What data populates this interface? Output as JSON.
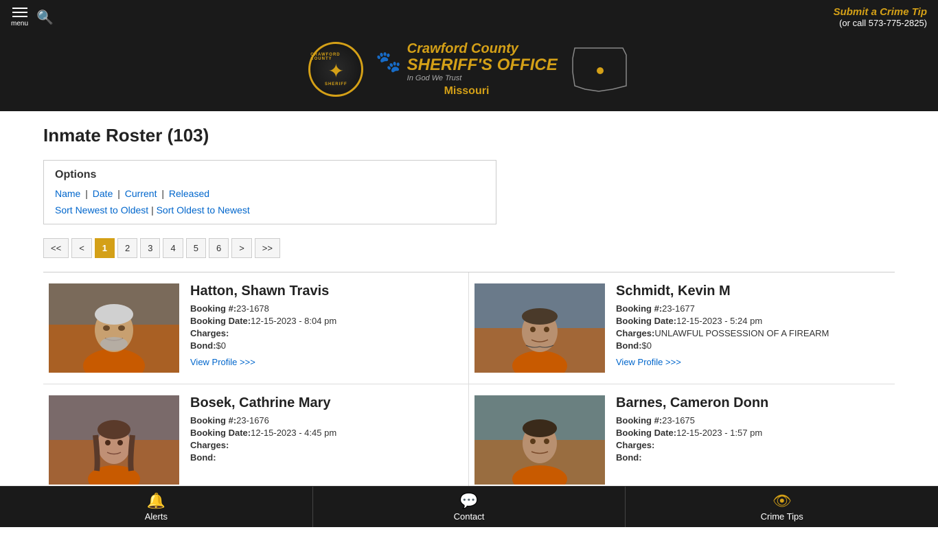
{
  "header": {
    "menu_label": "menu",
    "crime_tip_text": "Submit a Crime Tip",
    "crime_tip_phone": "(or call 573-775-2825)"
  },
  "logo": {
    "county": "Crawford County",
    "office": "SHERIFF'S OFFICE",
    "tagline": "In God We Trust",
    "state": "Missouri"
  },
  "page": {
    "title": "Inmate Roster (103)"
  },
  "options": {
    "title": "Options",
    "filter_links": [
      {
        "label": "Name",
        "href": "#"
      },
      {
        "label": "Date",
        "href": "#"
      },
      {
        "label": "Current",
        "href": "#"
      },
      {
        "label": "Released",
        "href": "#"
      }
    ],
    "sort_links": [
      {
        "label": "Sort Newest to Oldest",
        "href": "#"
      },
      {
        "label": "Sort Oldest to Newest",
        "href": "#"
      }
    ]
  },
  "pagination": {
    "buttons": [
      "<<",
      "<",
      "1",
      "2",
      "3",
      "4",
      "5",
      "6",
      ">",
      ">>"
    ],
    "active": "1"
  },
  "inmates": [
    {
      "name": "Hatton, Shawn Travis",
      "booking_num": "23-1678",
      "booking_date": "12-15-2023 - 8:04 pm",
      "charges": "",
      "bond": "$0",
      "view_profile": "View Profile >>>"
    },
    {
      "name": "Schmidt, Kevin M",
      "booking_num": "23-1677",
      "booking_date": "12-15-2023 - 5:24 pm",
      "charges": "UNLAWFUL POSSESSION OF A FIREARM",
      "bond": "$0",
      "view_profile": "View Profile >>>"
    },
    {
      "name": "Bosek, Cathrine Mary",
      "booking_num": "23-1676",
      "booking_date": "12-15-2023 - 4:45 pm",
      "charges": "",
      "bond": "",
      "view_profile": ""
    },
    {
      "name": "Barnes, Cameron Donn",
      "booking_num": "23-1675",
      "booking_date": "12-15-2023 - 1:57 pm",
      "charges": "",
      "bond": "",
      "view_profile": ""
    }
  ],
  "bottom_nav": [
    {
      "label": "Alerts",
      "icon": "🔔"
    },
    {
      "label": "Contact",
      "icon": "💬"
    },
    {
      "label": "Crime Tips",
      "icon": "👁"
    }
  ],
  "labels": {
    "booking_num": "Booking #:",
    "booking_date": "Booking Date:",
    "charges": "Charges:",
    "bond": "Bond:"
  }
}
